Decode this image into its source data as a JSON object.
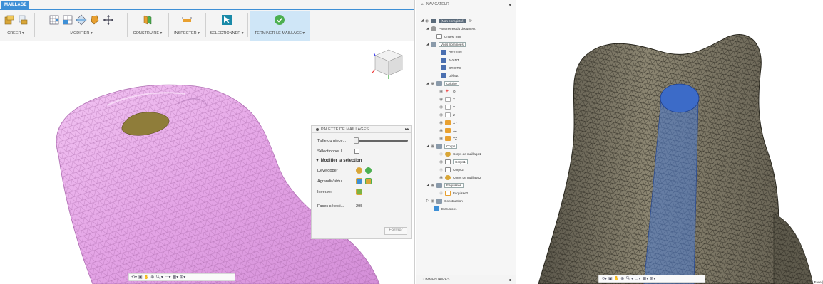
{
  "ribbon": {
    "tab_label": "MAILLAGE",
    "groups": {
      "creer": "CRÉER ▾",
      "modifier": "MODIFIER ▾",
      "construire": "CONSTRUIRE ▾",
      "inspecter": "INSPECTER ▾",
      "selectionner": "SÉLECTIONNER ▾",
      "terminer": "TERMINER LE MAILLAGE ▾"
    },
    "accent_color": "#3d8fd6"
  },
  "palette": {
    "title": "PALETTE DE MAILLAGES",
    "collapse_glyph": "▸▸",
    "rows": {
      "taille": "Taille du pince...",
      "selectionner": "Sélectionner l...",
      "section": "▼ Modifier la sélection",
      "developper": "Développer",
      "agrandir": "Agrandir/rédu...",
      "inverser": "Inverser",
      "faces_label": "Faces sélecti...",
      "faces_value": "295"
    },
    "close_label": "Fermer"
  },
  "browser": {
    "title": "NAVIGATEUR",
    "footer": "COMMENTAIRES",
    "root": "(Non enregistré)",
    "items": {
      "params": "Paramètres du document",
      "units": "Unités: mm",
      "saved_views": "Vues nommées",
      "dessus": "DESSUS",
      "avant": "AVANT",
      "droite": "DROITE",
      "defaut": "Défaut",
      "origine": "Origine",
      "o": "O",
      "x": "X",
      "y": "Y",
      "z": "Z",
      "xy": "XY",
      "xz": "XZ",
      "yz": "YZ",
      "corps": "Corps",
      "corps_maillage1": "Corps de maillage1",
      "corps1": "Corps1",
      "corps2": "Corps2",
      "corps_maillage2": "Corps de maillage2",
      "esquisses": "Esquisses",
      "esquisse2": "Esquisse2",
      "construction": "Construction",
      "extrusion": "Extrusion1"
    }
  },
  "right_view": {
    "faces_tag": "1 Face |"
  }
}
